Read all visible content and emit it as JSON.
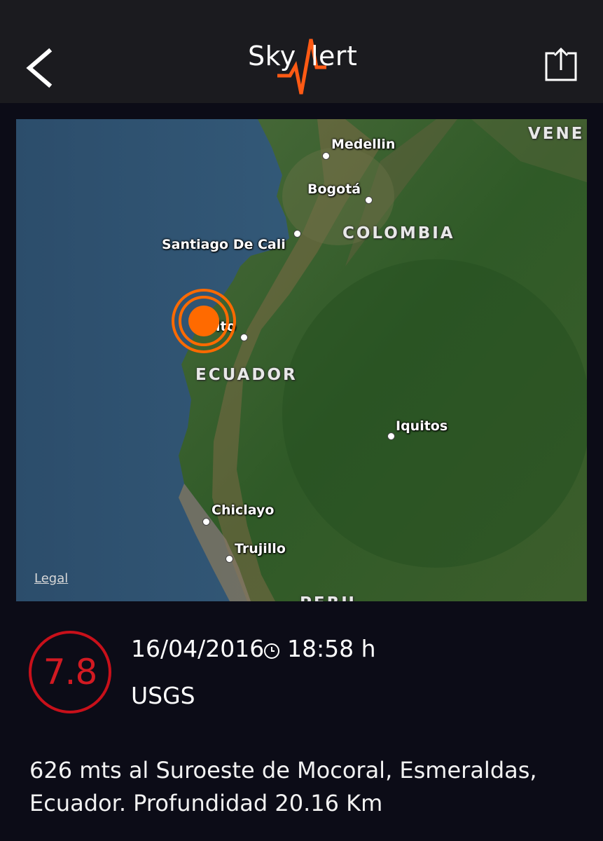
{
  "header": {
    "logo_left": "Sky",
    "logo_right": "lert",
    "back_icon": "chevron-left-icon",
    "share_icon": "share-icon"
  },
  "map": {
    "legal": "Legal",
    "cities": [
      {
        "label": "Medellin"
      },
      {
        "label": "Bogotá"
      },
      {
        "label": "Santiago De Cali"
      },
      {
        "label": "ito"
      },
      {
        "label": "Iquitos"
      },
      {
        "label": "Chiclayo"
      },
      {
        "label": "Trujillo"
      }
    ],
    "countries": [
      {
        "label": "VENE"
      },
      {
        "label": "COLOMBIA"
      },
      {
        "label": "ECUADOR"
      },
      {
        "label": "PERU"
      }
    ],
    "epicenter_icon": "epicenter-marker-icon",
    "epicenter_color": "#ff6a00"
  },
  "event": {
    "magnitude": "7.8",
    "date": "16/04/2016",
    "time": "18:58 h",
    "source": "USGS",
    "description": "626 mts al Suroeste de Mocoral, Esmeraldas, Ecuador. Profundidad 20.16 Km",
    "magnitude_color": "#d21a22"
  },
  "colors": {
    "background": "#0c0c17",
    "header": "#1b1b1f",
    "accent": "#ff6a00"
  }
}
